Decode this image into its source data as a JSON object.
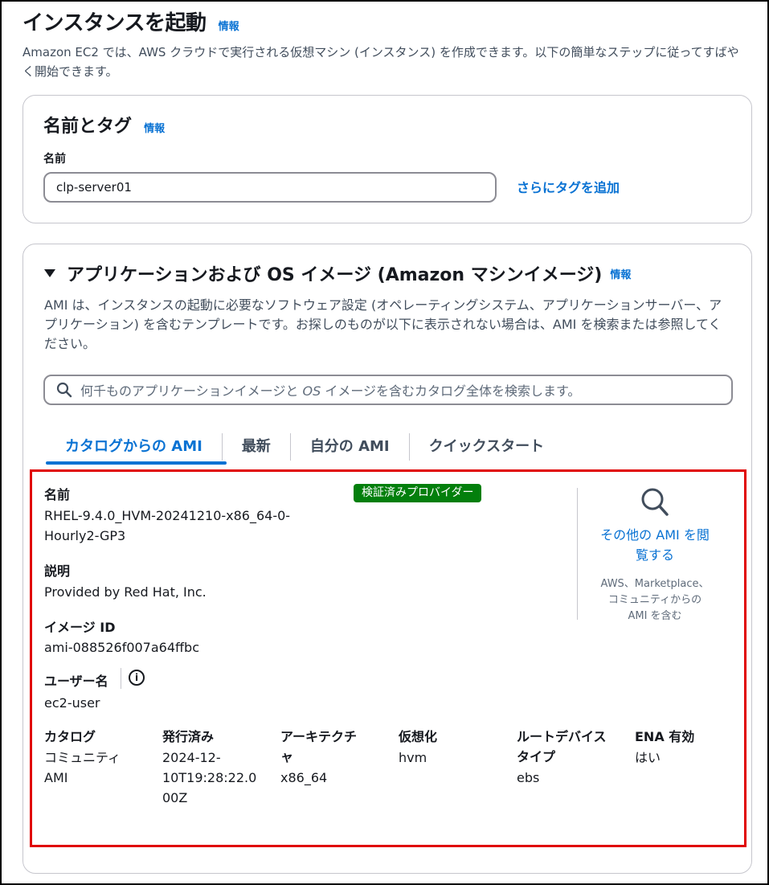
{
  "page": {
    "title": "インスタンスを起動",
    "info": "情報",
    "description": "Amazon EC2 では、AWS クラウドで実行される仮想マシン (インスタンス) を作成できます。以下の簡単なステップに従ってすばやく開始できます。"
  },
  "name_tags": {
    "title": "名前とタグ",
    "info": "情報",
    "name_label": "名前",
    "name_value": "clp-server01",
    "add_tags": "さらにタグを追加"
  },
  "ami_section": {
    "title": "アプリケーションおよび OS イメージ (Amazon マシンイメージ)",
    "info": "情報",
    "description": "AMI は、インスタンスの起動に必要なソフトウェア設定 (オペレーティングシステム、アプリケーションサーバー、アプリケーション) を含むテンプレートです。お探しのものが以下に表示されない場合は、AMI を検索または参照してください。",
    "search_placeholder_pre": "何千ものアプリケーションイメージと",
    "search_placeholder_em": "OS",
    "search_placeholder_post": "イメージを含むカタログ全体を検索します。",
    "tabs": [
      {
        "label": "カタログからの AMI"
      },
      {
        "label": "最新"
      },
      {
        "label": "自分の AMI"
      },
      {
        "label": "クイックスタート"
      }
    ]
  },
  "ami_detail": {
    "name_label": "名前",
    "name_value_line1": "RHEL-9.4.0_HVM-20241210-x86_64-0-",
    "name_value_line2": "Hourly2-GP3",
    "badge": "検証済みプロバイダー",
    "description_label": "説明",
    "description_value": "Provided by Red Hat, Inc.",
    "image_id_label": "イメージ ID",
    "image_id_value": "ami-088526f007a64ffbc",
    "username_label": "ユーザー名",
    "info_glyph": "i",
    "username_value": "ec2-user",
    "browse_link_line1": "その他の AMI を閲",
    "browse_link_line2": "覧する",
    "browse_sub_line1": "AWS、Marketplace、",
    "browse_sub_line2": "コミュニティからの",
    "browse_sub_line3": "AMI を含む",
    "columns": [
      {
        "label_lines": [
          "カタログ"
        ],
        "value_lines": [
          "コミュニティ",
          "AMI"
        ]
      },
      {
        "label_lines": [
          "発行済み"
        ],
        "value_lines": [
          "2024-12-",
          "10T19:28:22.0",
          "00Z"
        ]
      },
      {
        "label_lines": [
          "アーキテクチ",
          "ャ"
        ],
        "value_lines": [
          "",
          "x86_64"
        ]
      },
      {
        "label_lines": [
          "仮想化"
        ],
        "value_lines": [
          "hvm"
        ]
      },
      {
        "label_lines": [
          "ルートデバイス",
          "タイプ"
        ],
        "value_lines": [
          "",
          "ebs"
        ]
      },
      {
        "label_lines": [
          "ENA 有効"
        ],
        "value_lines": [
          "はい"
        ]
      }
    ]
  },
  "colors": {
    "link": "#0972d3",
    "badge": "#037f0c",
    "highlight_border": "#e00000"
  }
}
